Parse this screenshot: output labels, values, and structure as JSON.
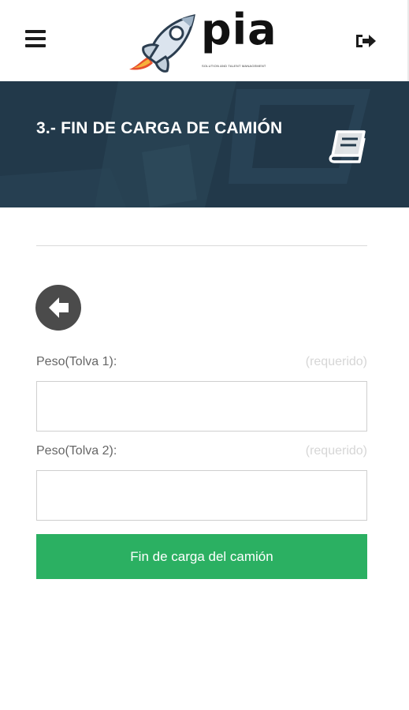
{
  "header": {
    "menu_icon": "hamburger-menu-icon",
    "logo_text": "pia",
    "logo_tagline": "SOLUTION AND TALENT MANAGEMENT",
    "logout_icon": "sign-out-icon"
  },
  "banner": {
    "title": "3.- FIN DE CARGA DE CAMIÓN",
    "icon": "book-icon"
  },
  "form": {
    "back_icon": "arrow-left-circle-icon",
    "fields": [
      {
        "label": "Peso(Tolva 1):",
        "required_text": "(requerido)",
        "value": "",
        "placeholder": ""
      },
      {
        "label": "Peso(Tolva 2):",
        "required_text": "(requerido)",
        "value": "",
        "placeholder": ""
      }
    ],
    "submit_label": "Fin de carga del camión"
  },
  "colors": {
    "banner_bg": "#22394a",
    "submit_bg": "#2bb062",
    "back_button_bg": "#4b4b4b"
  }
}
